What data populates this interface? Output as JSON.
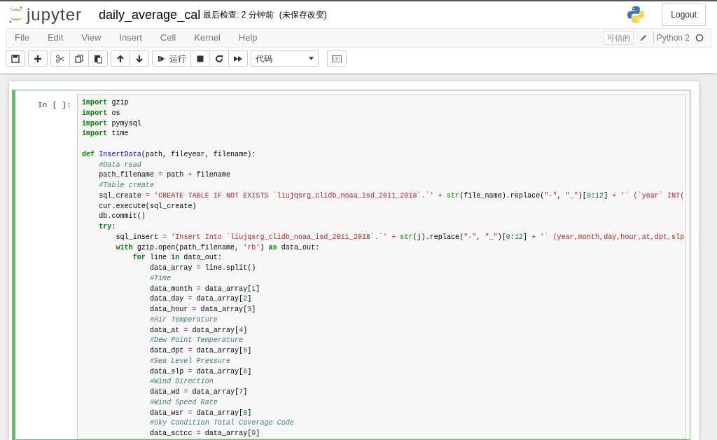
{
  "header": {
    "logo_text": "jupyter",
    "notebook_name": "daily_average_cal",
    "checkpoint": "最后检查: 2 分钟前",
    "autosave_status": "(未保存改变)",
    "logout": "Logout"
  },
  "menu": [
    "File",
    "Edit",
    "View",
    "Insert",
    "Cell",
    "Kernel",
    "Help"
  ],
  "kernel": {
    "trusted": "可信的",
    "name": "Python 2",
    "busy": false
  },
  "toolbar": [
    [
      {
        "kind": "save"
      }
    ],
    [
      {
        "kind": "plus"
      }
    ],
    [
      {
        "kind": "cut"
      },
      {
        "kind": "copy"
      },
      {
        "kind": "paste"
      }
    ],
    [
      {
        "kind": "up"
      },
      {
        "kind": "down"
      }
    ],
    [
      {
        "kind": "run",
        "label": "运行"
      },
      {
        "kind": "stop"
      },
      {
        "kind": "restart"
      },
      {
        "kind": "forward"
      }
    ]
  ],
  "cell_type": {
    "value": "代码"
  },
  "cell": {
    "prompt": "In [ ]:",
    "edit_mode": true,
    "lines": [
      {
        "kind": "code",
        "tokens": [
          {
            "kind": "kw",
            "text": "import"
          },
          {
            "kind": "plain",
            "text": " gzip"
          }
        ]
      },
      {
        "kind": "code",
        "tokens": [
          {
            "kind": "kw",
            "text": "import"
          },
          {
            "kind": "plain",
            "text": " os"
          }
        ]
      },
      {
        "kind": "code",
        "tokens": [
          {
            "kind": "kw",
            "text": "import"
          },
          {
            "kind": "plain",
            "text": " pymysql"
          }
        ]
      },
      {
        "kind": "code",
        "tokens": [
          {
            "kind": "kw",
            "text": "import"
          },
          {
            "kind": "plain",
            "text": " time"
          }
        ]
      },
      {
        "kind": "blank"
      },
      {
        "kind": "code",
        "tokens": [
          {
            "kind": "kw",
            "text": "def"
          },
          {
            "kind": "def",
            "text": " InsertData"
          },
          {
            "kind": "plain",
            "text": "(path, fileyear, filename):"
          }
        ],
        "children": [
          {
            "kind": "code",
            "tokens": [
              {
                "kind": "comment",
                "text": "#Data read"
              }
            ]
          },
          {
            "kind": "code",
            "tokens": [
              {
                "kind": "plain",
                "text": "path_filename "
              },
              {
                "kind": "op",
                "text": "="
              },
              {
                "kind": "plain",
                "text": " path "
              },
              {
                "kind": "op",
                "text": "+"
              },
              {
                "kind": "plain",
                "text": " filename"
              }
            ]
          },
          {
            "kind": "code",
            "tokens": [
              {
                "kind": "comment",
                "text": "#Table create"
              }
            ]
          },
          {
            "kind": "code",
            "tokens": [
              {
                "kind": "plain",
                "text": "sql_create "
              },
              {
                "kind": "op",
                "text": "="
              },
              {
                "kind": "str",
                "text": " 'CREATE TABLE IF NOT EXISTS `liujqsrg_clidb_noaa_isd_2011_2018`.`'"
              },
              {
                "kind": "op",
                "text": " +"
              },
              {
                "kind": "builtin",
                "text": " str"
              },
              {
                "kind": "plain",
                "text": "(file_name).replace("
              },
              {
                "kind": "str",
                "text": "\"-\""
              },
              {
                "kind": "plain",
                "text": ", "
              },
              {
                "kind": "str",
                "text": "\"_\""
              },
              {
                "kind": "plain",
                "text": ")["
              },
              {
                "kind": "num",
                "text": "0"
              },
              {
                "kind": "plain",
                "text": ":"
              },
              {
                "kind": "num",
                "text": "12"
              },
              {
                "kind": "plain",
                "text": "] "
              },
              {
                "kind": "op",
                "text": "+"
              },
              {
                "kind": "str",
                "text": " '` (`year` INT("
              }
            ]
          },
          {
            "kind": "code",
            "tokens": [
              {
                "kind": "plain",
                "text": "cur.execute(sql_create)"
              }
            ]
          },
          {
            "kind": "code",
            "tokens": [
              {
                "kind": "plain",
                "text": "db.commit()"
              }
            ]
          },
          {
            "kind": "code",
            "tokens": [
              {
                "kind": "kw",
                "text": "try"
              },
              {
                "kind": "plain",
                "text": ":"
              }
            ],
            "children": [
              {
                "kind": "code",
                "tokens": [
                  {
                    "kind": "plain",
                    "text": "sql_insert "
                  },
                  {
                    "kind": "op",
                    "text": "="
                  },
                  {
                    "kind": "str",
                    "text": " 'Insert Into `liujqsrg_clidb_noaa_isd_2011_2018`.`'"
                  },
                  {
                    "kind": "op",
                    "text": " +"
                  },
                  {
                    "kind": "builtin",
                    "text": " str"
                  },
                  {
                    "kind": "plain",
                    "text": "(j).replace("
                  },
                  {
                    "kind": "str",
                    "text": "\"-\""
                  },
                  {
                    "kind": "plain",
                    "text": ", "
                  },
                  {
                    "kind": "str",
                    "text": "\"_\""
                  },
                  {
                    "kind": "plain",
                    "text": ")["
                  },
                  {
                    "kind": "num",
                    "text": "0"
                  },
                  {
                    "kind": "plain",
                    "text": ":"
                  },
                  {
                    "kind": "num",
                    "text": "12"
                  },
                  {
                    "kind": "plain",
                    "text": "] "
                  },
                  {
                    "kind": "op",
                    "text": "+"
                  },
                  {
                    "kind": "str",
                    "text": " '` (year,month,day,hour,at,dpt,slp"
                  }
                ]
              },
              {
                "kind": "code",
                "tokens": [
                  {
                    "kind": "kw",
                    "text": "with"
                  },
                  {
                    "kind": "plain",
                    "text": " gzip.open(path_filename, "
                  },
                  {
                    "kind": "str",
                    "text": "'rb'"
                  },
                  {
                    "kind": "plain",
                    "text": ") "
                  },
                  {
                    "kind": "kw",
                    "text": "as"
                  },
                  {
                    "kind": "plain",
                    "text": " data_out:"
                  }
                ],
                "children": [
                  {
                    "kind": "code",
                    "tokens": [
                      {
                        "kind": "kw",
                        "text": "for"
                      },
                      {
                        "kind": "plain",
                        "text": " line "
                      },
                      {
                        "kind": "kw",
                        "text": "in"
                      },
                      {
                        "kind": "plain",
                        "text": " data_out:"
                      }
                    ],
                    "children": [
                      {
                        "kind": "code",
                        "tokens": [
                          {
                            "kind": "plain",
                            "text": "data_array "
                          },
                          {
                            "kind": "op",
                            "text": "="
                          },
                          {
                            "kind": "plain",
                            "text": " line.split()"
                          }
                        ]
                      },
                      {
                        "kind": "code",
                        "tokens": [
                          {
                            "kind": "comment",
                            "text": "#Time"
                          }
                        ]
                      },
                      {
                        "kind": "code",
                        "tokens": [
                          {
                            "kind": "plain",
                            "text": "data_month "
                          },
                          {
                            "kind": "op",
                            "text": "="
                          },
                          {
                            "kind": "plain",
                            "text": " data_array["
                          },
                          {
                            "kind": "num",
                            "text": "1"
                          },
                          {
                            "kind": "plain",
                            "text": "]"
                          }
                        ]
                      },
                      {
                        "kind": "code",
                        "tokens": [
                          {
                            "kind": "plain",
                            "text": "data_day "
                          },
                          {
                            "kind": "op",
                            "text": "="
                          },
                          {
                            "kind": "plain",
                            "text": " data_array["
                          },
                          {
                            "kind": "num",
                            "text": "2"
                          },
                          {
                            "kind": "plain",
                            "text": "]"
                          }
                        ]
                      },
                      {
                        "kind": "code",
                        "tokens": [
                          {
                            "kind": "plain",
                            "text": "data_hour "
                          },
                          {
                            "kind": "op",
                            "text": "="
                          },
                          {
                            "kind": "plain",
                            "text": " data_array["
                          },
                          {
                            "kind": "num",
                            "text": "3"
                          },
                          {
                            "kind": "plain",
                            "text": "]"
                          }
                        ]
                      },
                      {
                        "kind": "code",
                        "tokens": [
                          {
                            "kind": "comment",
                            "text": "#Air Temperature"
                          }
                        ]
                      },
                      {
                        "kind": "code",
                        "tokens": [
                          {
                            "kind": "plain",
                            "text": "data_at "
                          },
                          {
                            "kind": "op",
                            "text": "="
                          },
                          {
                            "kind": "plain",
                            "text": " data_array["
                          },
                          {
                            "kind": "num",
                            "text": "4"
                          },
                          {
                            "kind": "plain",
                            "text": "]"
                          }
                        ]
                      },
                      {
                        "kind": "code",
                        "tokens": [
                          {
                            "kind": "comment",
                            "text": "#Dew Point Temperature"
                          }
                        ]
                      },
                      {
                        "kind": "code",
                        "tokens": [
                          {
                            "kind": "plain",
                            "text": "data_dpt "
                          },
                          {
                            "kind": "op",
                            "text": "="
                          },
                          {
                            "kind": "plain",
                            "text": " data_array["
                          },
                          {
                            "kind": "num",
                            "text": "5"
                          },
                          {
                            "kind": "plain",
                            "text": "]"
                          }
                        ]
                      },
                      {
                        "kind": "code",
                        "tokens": [
                          {
                            "kind": "comment",
                            "text": "#Sea Level Pressure"
                          }
                        ]
                      },
                      {
                        "kind": "code",
                        "tokens": [
                          {
                            "kind": "plain",
                            "text": "data_slp "
                          },
                          {
                            "kind": "op",
                            "text": "="
                          },
                          {
                            "kind": "plain",
                            "text": " data_array["
                          },
                          {
                            "kind": "num",
                            "text": "6"
                          },
                          {
                            "kind": "plain",
                            "text": "]"
                          }
                        ]
                      },
                      {
                        "kind": "code",
                        "tokens": [
                          {
                            "kind": "comment",
                            "text": "#Wind Direction"
                          }
                        ]
                      },
                      {
                        "kind": "code",
                        "tokens": [
                          {
                            "kind": "plain",
                            "text": "data_wd "
                          },
                          {
                            "kind": "op",
                            "text": "="
                          },
                          {
                            "kind": "plain",
                            "text": " data_array["
                          },
                          {
                            "kind": "num",
                            "text": "7"
                          },
                          {
                            "kind": "plain",
                            "text": "]"
                          }
                        ]
                      },
                      {
                        "kind": "code",
                        "tokens": [
                          {
                            "kind": "comment",
                            "text": "#Wind Speed Rate"
                          }
                        ]
                      },
                      {
                        "kind": "code",
                        "tokens": [
                          {
                            "kind": "plain",
                            "text": "data_wsr "
                          },
                          {
                            "kind": "op",
                            "text": "="
                          },
                          {
                            "kind": "plain",
                            "text": " data_array["
                          },
                          {
                            "kind": "num",
                            "text": "8"
                          },
                          {
                            "kind": "plain",
                            "text": "]"
                          }
                        ]
                      },
                      {
                        "kind": "code",
                        "tokens": [
                          {
                            "kind": "comment",
                            "text": "#Sky Condition Total Coverage Code"
                          }
                        ]
                      },
                      {
                        "kind": "code",
                        "tokens": [
                          {
                            "kind": "plain",
                            "text": "data_sctcc "
                          },
                          {
                            "kind": "op",
                            "text": "="
                          },
                          {
                            "kind": "plain",
                            "text": " data_array["
                          },
                          {
                            "kind": "num",
                            "text": "9"
                          },
                          {
                            "kind": "plain",
                            "text": "]"
                          }
                        ]
                      }
                    ]
                  }
                ]
              }
            ]
          }
        ]
      }
    ]
  }
}
